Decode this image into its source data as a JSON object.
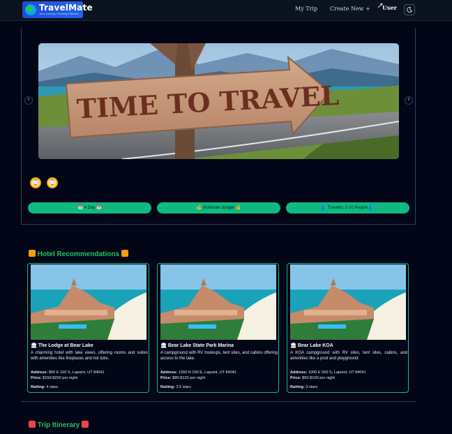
{
  "header": {
    "brand": "TravelMate",
    "tagline": "Your Journey, Perfectly Planned",
    "links": [
      "My Trip",
      "Create New +"
    ],
    "user": "User",
    "theme_icon": "moon-icon"
  },
  "hero": {
    "sign_text": "TIME TO TRAVEL",
    "prev_icon": "chevron-left-icon",
    "next_icon": "chevron-right-icon"
  },
  "trip_info": {
    "duration": "📅 4 Day 📅",
    "budget": "💰 Moderate budget 💰",
    "travelers": "👥 Travelor: 5-10 People 👥"
  },
  "hotels": {
    "title": "Hotel Recommendations",
    "labels": {
      "address": "Address:",
      "price": "Price:",
      "rating": "Raiting:"
    },
    "items": [
      {
        "name": "The Lodge at Bear Lake",
        "description": "A charming hotel with lake views, offering rooms and suites with amenities like fireplaces and hot tubs.",
        "address": "850 E 100 S, Lapoint, UT 84041",
        "price": "$150-$250 per night",
        "rating": "4 stars"
      },
      {
        "name": "Bear Lake State Park Marina",
        "description": "A campground with RV hookups, tent sites, and cabins offering access to the lake.",
        "address": "1393 N 100 E, Lapoint, UT 84041",
        "price": "$80-$120 per night",
        "rating": "3.5 stars"
      },
      {
        "name": "Bear Lake KOA",
        "description": "A KOA campground with RV sites, tent sites, cabins, and amenities like a pool and playground.",
        "address": "1000 E 500 S, Lapoint, UT 84041",
        "price": "$50-$100 per night",
        "rating": "3 stars"
      }
    ]
  },
  "itinerary": {
    "title": "Trip Itinerary"
  },
  "colors": {
    "accent": "#10b981",
    "title_green": "#22c55e",
    "background": "#020617",
    "brand_blue": "#2563eb"
  }
}
